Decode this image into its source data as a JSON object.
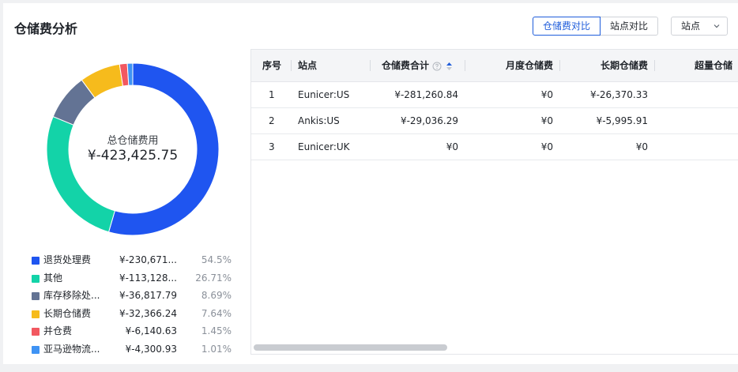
{
  "header": {
    "title": "仓储费分析",
    "segments": [
      "仓储费对比",
      "站点对比"
    ],
    "active_segment": "仓储费对比",
    "site_select": "站点"
  },
  "donut": {
    "center_label": "总仓储费用",
    "center_value": "¥-423,425.75"
  },
  "chart_data": {
    "type": "pie",
    "variant": "donut",
    "title": "",
    "slices": [
      {
        "name": "退货处理费",
        "value_text": "¥-230,671...",
        "percent": 54.5,
        "percent_text": "54.5%",
        "color": "#1f55f0"
      },
      {
        "name": "其他",
        "value_text": "¥-113,128...",
        "percent": 26.71,
        "percent_text": "26.71%",
        "color": "#13d3a8"
      },
      {
        "name": "库存移除处...",
        "value_text": "¥-36,817.79",
        "percent": 8.69,
        "percent_text": "8.69%",
        "color": "#637394"
      },
      {
        "name": "长期仓储费",
        "value_text": "¥-32,366.24",
        "percent": 7.64,
        "percent_text": "7.64%",
        "color": "#f6bb1c"
      },
      {
        "name": "并仓费",
        "value_text": "¥-6,140.63",
        "percent": 1.45,
        "percent_text": "1.45%",
        "color": "#f25860"
      },
      {
        "name": "亚马逊物流...",
        "value_text": "¥-4,300.93",
        "percent": 1.01,
        "percent_text": "1.01%",
        "color": "#3f93f4"
      }
    ]
  },
  "table": {
    "columns": [
      "序号",
      "站点",
      "仓储费合计",
      "月度仓储费",
      "长期仓储费",
      "超量仓储"
    ],
    "rows": [
      {
        "index": "1",
        "site": "Eunicer:US",
        "total": "¥-281,260.84",
        "monthly": "¥0",
        "long_term": "¥-26,370.33"
      },
      {
        "index": "2",
        "site": "Ankis:US",
        "total": "¥-29,036.29",
        "monthly": "¥0",
        "long_term": "¥-5,995.91"
      },
      {
        "index": "3",
        "site": "Eunicer:UK",
        "total": "¥0",
        "monthly": "¥0",
        "long_term": "¥0"
      }
    ]
  },
  "icons": {
    "help": "help-circle-icon",
    "sort": "sort-caret-icon",
    "chevron": "chevron-down-icon"
  },
  "colors": {
    "accent": "#1f5ddb",
    "header_bg": "#f4f5f7"
  }
}
